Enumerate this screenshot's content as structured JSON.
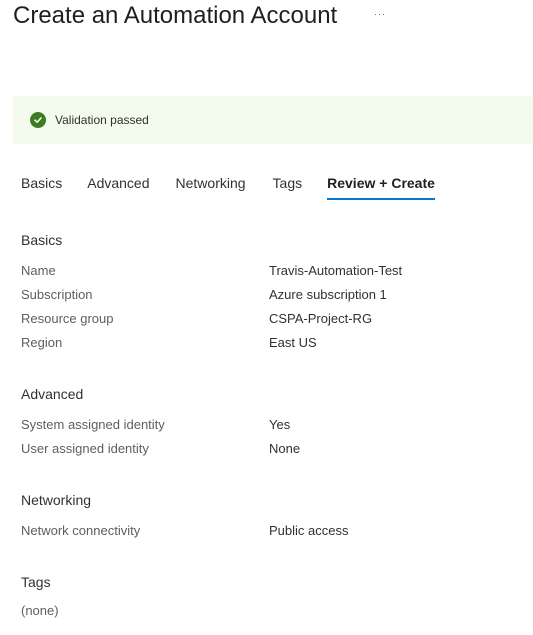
{
  "page": {
    "title": "Create an Automation Account",
    "more_label": "···"
  },
  "banner": {
    "status": "success",
    "message": "Validation passed",
    "color": "#3c7d23",
    "icon": "checkmark-circle-icon"
  },
  "tabs": [
    {
      "label": "Basics",
      "active": false
    },
    {
      "label": "Advanced",
      "active": false
    },
    {
      "label": "Networking",
      "active": false
    },
    {
      "label": "Tags",
      "active": false
    },
    {
      "label": "Review + Create",
      "active": true
    }
  ],
  "accent": "#0078d4",
  "sections": {
    "basics": {
      "title": "Basics",
      "rows": [
        {
          "label": "Name",
          "value": "Travis-Automation-Test"
        },
        {
          "label": "Subscription",
          "value": "Azure subscription 1"
        },
        {
          "label": "Resource group",
          "value": "CSPA-Project-RG"
        },
        {
          "label": "Region",
          "value": "East US"
        }
      ]
    },
    "advanced": {
      "title": "Advanced",
      "rows": [
        {
          "label": "System assigned identity",
          "value": "Yes"
        },
        {
          "label": "User assigned identity",
          "value": "None"
        }
      ]
    },
    "networking": {
      "title": "Networking",
      "rows": [
        {
          "label": "Network connectivity",
          "value": "Public access"
        }
      ]
    },
    "tags": {
      "title": "Tags",
      "empty_text": "(none)"
    }
  }
}
